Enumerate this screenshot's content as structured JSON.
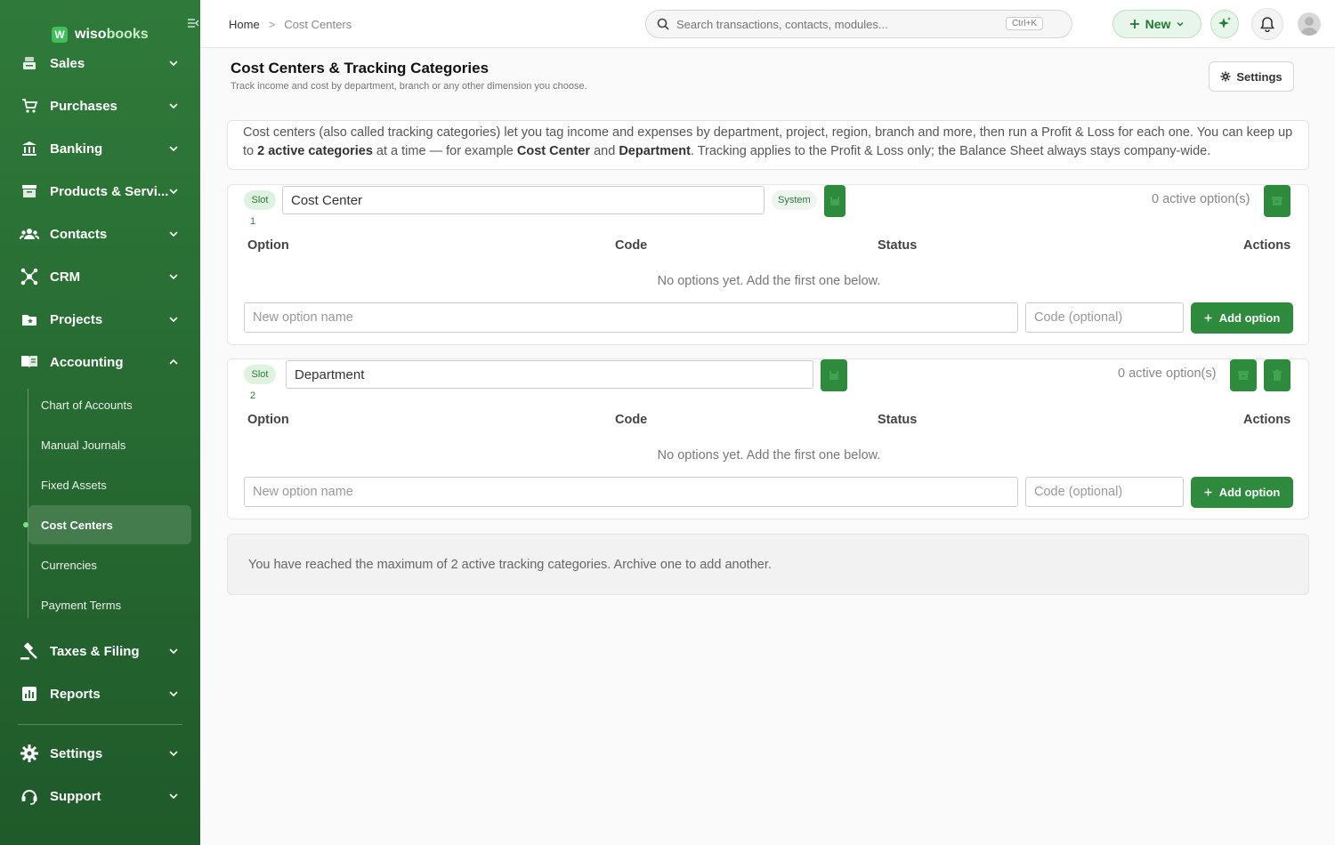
{
  "brand": {
    "name_prefix": "wiso",
    "name_suffix": "books",
    "mark": "W"
  },
  "sidebar": {
    "items": [
      {
        "label": "Sales",
        "icon": "register-icon"
      },
      {
        "label": "Purchases",
        "icon": "cart-icon"
      },
      {
        "label": "Banking",
        "icon": "bank-icon"
      },
      {
        "label": "Products & Servi...",
        "icon": "box-icon"
      },
      {
        "label": "Contacts",
        "icon": "people-icon"
      },
      {
        "label": "CRM",
        "icon": "hub-icon"
      },
      {
        "label": "Projects",
        "icon": "folder-star-icon"
      },
      {
        "label": "Accounting",
        "icon": "book-icon"
      },
      {
        "label": "Taxes & Filing",
        "icon": "gavel-icon"
      },
      {
        "label": "Reports",
        "icon": "chart-icon"
      },
      {
        "label": "Settings",
        "icon": "gear-icon"
      },
      {
        "label": "Support",
        "icon": "headset-icon"
      }
    ],
    "accounting_sub": [
      "Chart of Accounts",
      "Manual Journals",
      "Fixed Assets",
      "Cost Centers",
      "Currencies",
      "Payment Terms"
    ]
  },
  "topbar": {
    "breadcrumb_home": "Home",
    "breadcrumb_sep": ">",
    "breadcrumb_current": "Cost Centers",
    "search_placeholder": "Search transactions, contacts, modules...",
    "search_shortcut": "Ctrl+K",
    "new_label": "New"
  },
  "page": {
    "title": "Cost Centers & Tracking Categories",
    "subtitle": "Track income and cost by department, branch or any other dimension you choose.",
    "settings_label": "Settings"
  },
  "info": {
    "p1": "Cost centers (also called tracking categories) let you tag income and expenses by department, project, region, branch and more, then run a Profit & Loss for each one. You can keep up to ",
    "b1": "2 active categories",
    "p2": " at a time — for example ",
    "b2": "Cost Center",
    "p3": " and ",
    "b3": "Department",
    "p4": ". Tracking applies to the Profit & Loss only; the Balance Sheet always stays company-wide."
  },
  "categories": [
    {
      "slot_label": "Slot",
      "slot_number": "1",
      "name": "Cost Center",
      "system_badge": "System",
      "active_count": "0 active option(s)",
      "col_option": "Option",
      "col_code": "Code",
      "col_status": "Status",
      "col_actions": "Actions",
      "empty": "No options yet. Add the first one below.",
      "new_option_placeholder": "New option name",
      "code_placeholder": "Code (optional)",
      "add_label": "Add option"
    },
    {
      "slot_label": "Slot",
      "slot_number": "2",
      "name": "Department",
      "active_count": "0 active option(s)",
      "col_option": "Option",
      "col_code": "Code",
      "col_status": "Status",
      "col_actions": "Actions",
      "empty": "No options yet. Add the first one below.",
      "new_option_placeholder": "New option name",
      "code_placeholder": "Code (optional)",
      "add_label": "Add option"
    }
  ],
  "limit_message": "You have reached the maximum of 2 active tracking categories. Archive one to add another.",
  "colors": {
    "accent": "#2e8b3e",
    "sidebar_top": "#2f7a3a",
    "sidebar_bottom": "#1f5a2a"
  }
}
